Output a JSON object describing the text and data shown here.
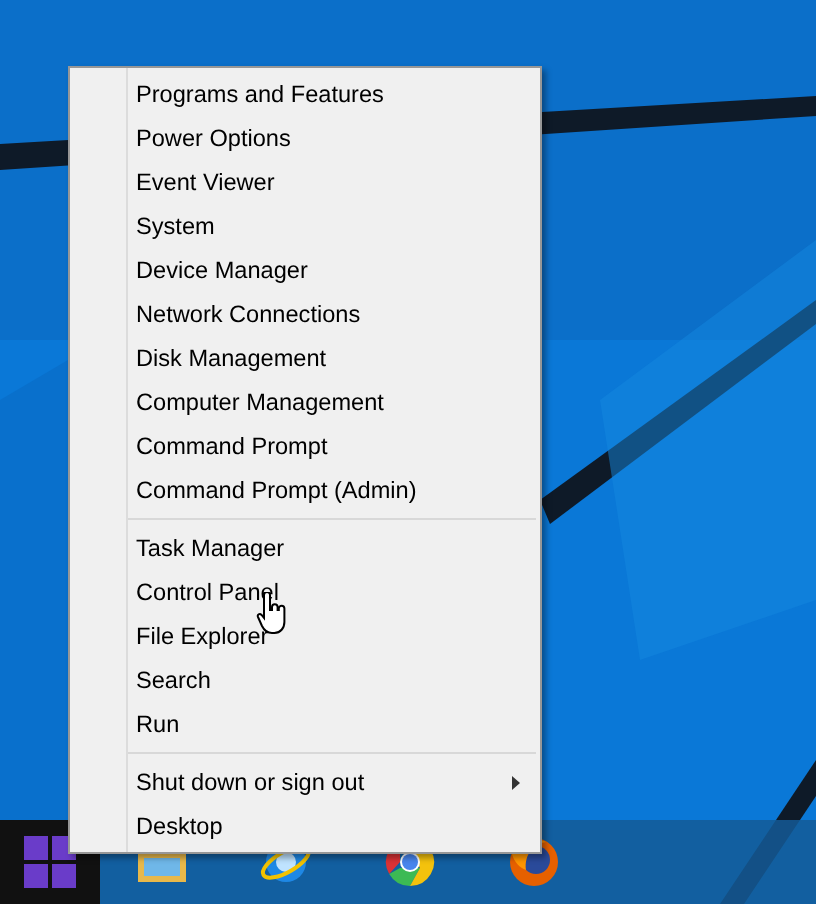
{
  "context_menu": {
    "groups": [
      [
        {
          "label": "Programs and Features"
        },
        {
          "label": "Power Options"
        },
        {
          "label": "Event Viewer"
        },
        {
          "label": "System"
        },
        {
          "label": "Device Manager"
        },
        {
          "label": "Network Connections"
        },
        {
          "label": "Disk Management"
        },
        {
          "label": "Computer Management"
        },
        {
          "label": "Command Prompt"
        },
        {
          "label": "Command Prompt (Admin)"
        }
      ],
      [
        {
          "label": "Task Manager"
        },
        {
          "label": "Control Panel"
        },
        {
          "label": "File Explorer"
        },
        {
          "label": "Search"
        },
        {
          "label": "Run"
        }
      ],
      [
        {
          "label": "Shut down or sign out",
          "has_submenu": true
        },
        {
          "label": "Desktop",
          "has_submenu": false
        }
      ]
    ]
  },
  "taskbar": {
    "apps": [
      {
        "kind": "folder"
      },
      {
        "kind": "orbit"
      },
      {
        "kind": "wheel"
      },
      {
        "kind": "globe"
      }
    ]
  }
}
